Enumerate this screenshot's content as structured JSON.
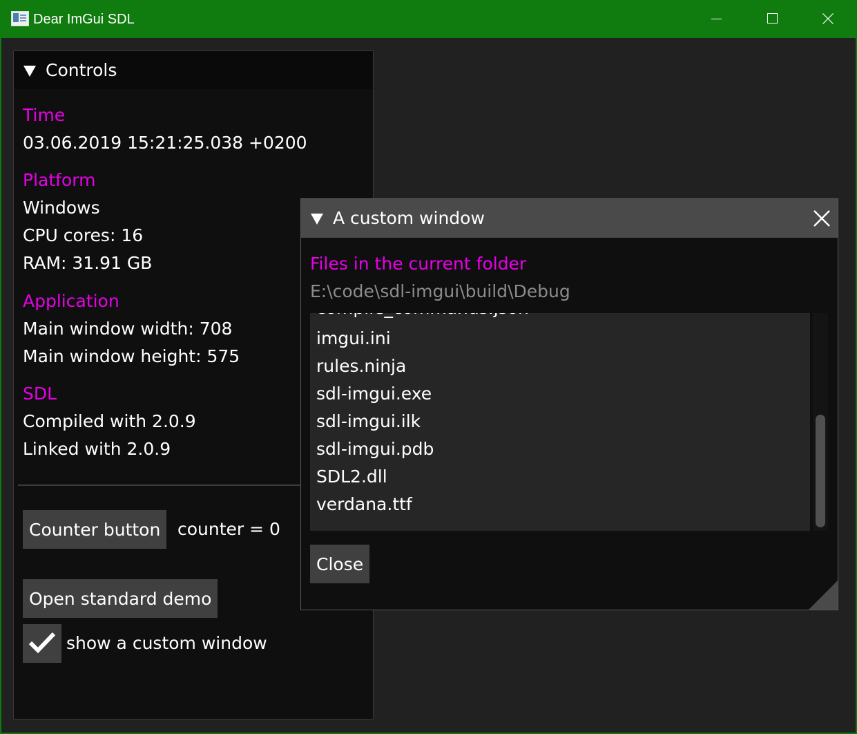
{
  "app": {
    "title": "Dear ImGui SDL"
  },
  "controls": {
    "title": "Controls",
    "time_header": "Time",
    "time_value": "03.06.2019 15:21:25.038 +0200",
    "platform_header": "Platform",
    "platform_os": "Windows",
    "cpu_cores": "CPU cores: 16",
    "ram": "RAM: 31.91 GB",
    "application_header": "Application",
    "main_width": "Main window width: 708",
    "main_height": "Main window height: 575",
    "sdl_header": "SDL",
    "sdl_compiled": "Compiled with 2.0.9",
    "sdl_linked": "Linked with 2.0.9",
    "counter_button": "Counter button",
    "counter_text": "counter = 0",
    "open_demo_button": "Open standard demo",
    "show_custom_label": "show a custom window",
    "show_custom_checked": true
  },
  "custom_window": {
    "title": "A custom window",
    "files_header": "Files in the current folder",
    "current_path": "E:\\code\\sdl-imgui\\build\\Debug",
    "files": [
      "compile_commands.json",
      "imgui.ini",
      "rules.ninja",
      "sdl-imgui.exe",
      "sdl-imgui.ilk",
      "sdl-imgui.pdb",
      "SDL2.dll",
      "verdana.ttf"
    ],
    "close_button": "Close"
  },
  "colors": {
    "titlebar": "#107c10",
    "header_text": "#e800e8",
    "window_bg": "#0f0f0f",
    "button_bg": "#404040"
  }
}
